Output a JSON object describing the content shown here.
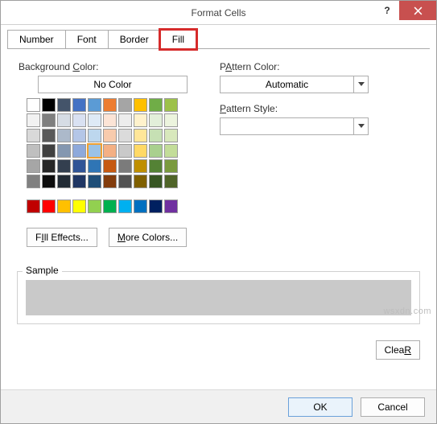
{
  "title": "Format Cells",
  "tabs": {
    "number": "Number",
    "font": "Font",
    "border": "Border",
    "fill": "Fill"
  },
  "left": {
    "bg_label": "Background Color:",
    "bg_underline": "C",
    "no_color": "No Color",
    "fill_effects": "Fill Effects...",
    "fill_effects_u": "I",
    "more_colors": "More Colors...",
    "more_colors_u": "M"
  },
  "right": {
    "pattern_color_label": "Pattern Color:",
    "pattern_color_u": "A",
    "pattern_color_value": "Automatic",
    "pattern_style_label": "Pattern Style:",
    "pattern_style_u": "P"
  },
  "sample_label": "Sample",
  "clear_label": "Clear",
  "clear_u": "R",
  "ok": "OK",
  "cancel": "Cancel",
  "watermark": "wsxdn.com",
  "theme_colors": [
    [
      "#ffffff",
      "#000000",
      "#44546a",
      "#4472c4",
      "#5b9bd5",
      "#ed7d31",
      "#a5a5a5",
      "#ffc000",
      "#70ad47",
      "#9dc14a"
    ],
    [
      "#f2f2f2",
      "#7f7f7f",
      "#d6dce4",
      "#d9e1f2",
      "#deeaf6",
      "#fce4d6",
      "#ededed",
      "#fff2cc",
      "#e2efda",
      "#ecf4de"
    ],
    [
      "#d9d9d9",
      "#595959",
      "#acb9ca",
      "#b4c6e7",
      "#bdd7ee",
      "#f8cbad",
      "#dbdbdb",
      "#ffe699",
      "#c6e0b4",
      "#d8e8bc"
    ],
    [
      "#bfbfbf",
      "#404040",
      "#8497b0",
      "#8ea9db",
      "#9bc2e6",
      "#f4b084",
      "#c9c9c9",
      "#ffd966",
      "#a9d08e",
      "#c3dd99"
    ],
    [
      "#a6a6a6",
      "#262626",
      "#333f4f",
      "#305496",
      "#2f75b5",
      "#c65911",
      "#7b7b7b",
      "#bf8f00",
      "#548235",
      "#7a9a3e"
    ],
    [
      "#808080",
      "#0d0d0d",
      "#222b35",
      "#203764",
      "#1f4e78",
      "#833c0c",
      "#525252",
      "#806000",
      "#375623",
      "#4f6428"
    ]
  ],
  "standard_colors": [
    "#c00000",
    "#ff0000",
    "#ffc000",
    "#ffff00",
    "#92d050",
    "#00b050",
    "#00b0f0",
    "#0070c0",
    "#002060",
    "#7030a0"
  ],
  "selected": "3,4"
}
